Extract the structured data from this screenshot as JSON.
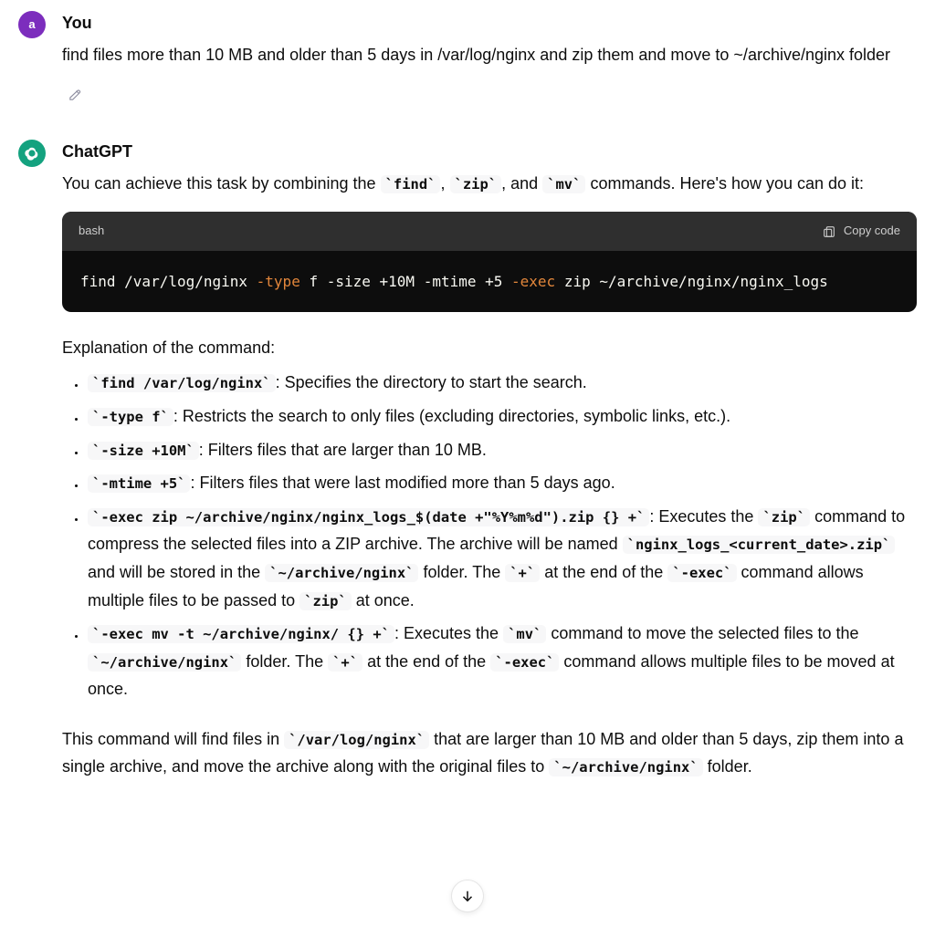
{
  "user": {
    "author_label": "You",
    "avatar_letter": "a",
    "message": "find files more than 10 MB and older than 5 days in /var/log/nginx and zip them and move to ~/archive/nginx folder"
  },
  "assistant": {
    "author_label": "ChatGPT",
    "intro_prefix": "You can achieve this task by combining the ",
    "intro_cmd1": "find",
    "intro_sep1": ", ",
    "intro_cmd2": "zip",
    "intro_sep2": ", and ",
    "intro_cmd3": "mv",
    "intro_suffix": " commands. Here's how you can do it:",
    "codeblock": {
      "language": "bash",
      "copy_label": "Copy code",
      "tokens": {
        "t0": "find /var/log/nginx ",
        "t1": "-type",
        "t2": " f -size +10M -mtime +5 ",
        "t3": "-exec",
        "t4": " zip ~/archive/nginx/nginx_logs"
      }
    },
    "explanation_heading": "Explanation of the command:",
    "explanation": [
      {
        "code": "find /var/log/nginx",
        "text": ": Specifies the directory to start the search."
      },
      {
        "code": "-type f",
        "text": ": Restricts the search to only files (excluding directories, symbolic links, etc.)."
      },
      {
        "code": "-size +10M",
        "text": ": Filters files that are larger than 10 MB."
      },
      {
        "code": "-mtime +5",
        "text": ": Filters files that were last modified more than 5 days ago."
      }
    ],
    "exp5": {
      "code_a": "-exec zip ~/archive/nginx/nginx_logs_$(date +\"%Y%m%d\").zip {} +",
      "txt_a": ": Executes the ",
      "code_b": "zip",
      "txt_b": " command to compress the selected files into a ZIP archive. The archive will be named ",
      "code_c": "nginx_logs_<current_date>.zip",
      "txt_c": " and will be stored in the ",
      "code_d": "~/archive/nginx",
      "txt_d": " folder. The ",
      "code_e": "+",
      "txt_e": " at the end of the ",
      "code_f": "-exec",
      "txt_f": " command allows multiple files to be passed to ",
      "code_g": "zip",
      "txt_g": " at once."
    },
    "exp6": {
      "code_a": "-exec mv -t ~/archive/nginx/ {} +",
      "txt_a": ": Executes the ",
      "code_b": "mv",
      "txt_b": " command to move the selected files to the ",
      "code_c": "~/archive/nginx",
      "txt_c": " folder. The ",
      "code_d": "+",
      "txt_d": " at the end of the ",
      "code_e": "-exec",
      "txt_e": " command allows multiple files to be moved at once."
    },
    "summary": {
      "p1": "This command will find files in ",
      "c1": "/var/log/nginx",
      "p2": " that are larger than 10 MB and older than 5 days, zip them into a single archive, and move the archive along with the original files to ",
      "c2": "~/archive/nginx",
      "p3": " folder."
    }
  },
  "icons": {
    "edit": "pencil-icon",
    "copy": "clipboard-icon",
    "scroll": "arrow-down-icon",
    "assistant": "openai-logo-icon"
  }
}
